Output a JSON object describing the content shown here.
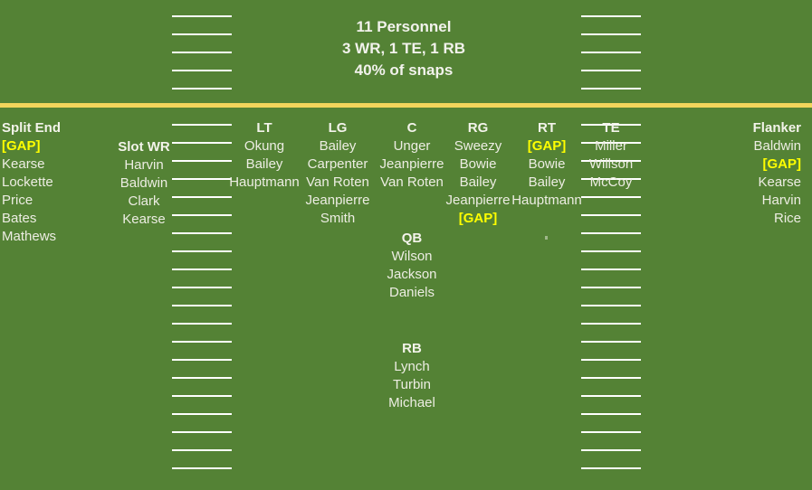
{
  "banner": {
    "line1": "11 Personnel",
    "line2": "3 WR, 1 TE, 1 RB",
    "line3": "40% of snaps"
  },
  "colors": {
    "field_green": "#548235",
    "gold_divider": "#F2D55C",
    "hash_white": "#FFFFFF",
    "text": "#EDEDE3",
    "gap_yellow": "#FFFF00"
  },
  "columns": {
    "split_end": {
      "header": "Split End",
      "players": [
        "[GAP]",
        "Kearse",
        "Lockette",
        "Price",
        "Bates",
        "Mathews"
      ]
    },
    "slot_wr": {
      "header": "Slot WR",
      "players": [
        "Harvin",
        "Baldwin",
        "Clark",
        "Kearse"
      ]
    },
    "lt": {
      "header": "LT",
      "players": [
        "Okung",
        "Bailey",
        "Hauptmann"
      ]
    },
    "lg": {
      "header": "LG",
      "players": [
        "Bailey",
        "Carpenter",
        "Van Roten",
        "Jeanpierre",
        "Smith"
      ]
    },
    "c": {
      "header": "C",
      "players": [
        "Unger",
        "Jeanpierre",
        "Van Roten"
      ]
    },
    "rg": {
      "header": "RG",
      "players": [
        "Sweezy",
        "Bowie",
        "Bailey",
        "Jeanpierre",
        "[GAP]"
      ]
    },
    "rt": {
      "header": "RT",
      "players": [
        "[GAP]",
        "Bowie",
        "Bailey",
        "Hauptmann"
      ]
    },
    "te": {
      "header": "TE",
      "players": [
        "Miller",
        "Willson",
        "McCoy"
      ]
    },
    "flanker": {
      "header": "Flanker",
      "players": [
        "Baldwin",
        "[GAP]",
        "Kearse",
        "Harvin",
        "Rice"
      ]
    },
    "qb": {
      "header": "QB",
      "players": [
        "Wilson",
        "Jackson",
        "Daniels"
      ]
    },
    "rb": {
      "header": "RB",
      "players": [
        "Lynch",
        "Turbin",
        "Michael"
      ]
    }
  }
}
